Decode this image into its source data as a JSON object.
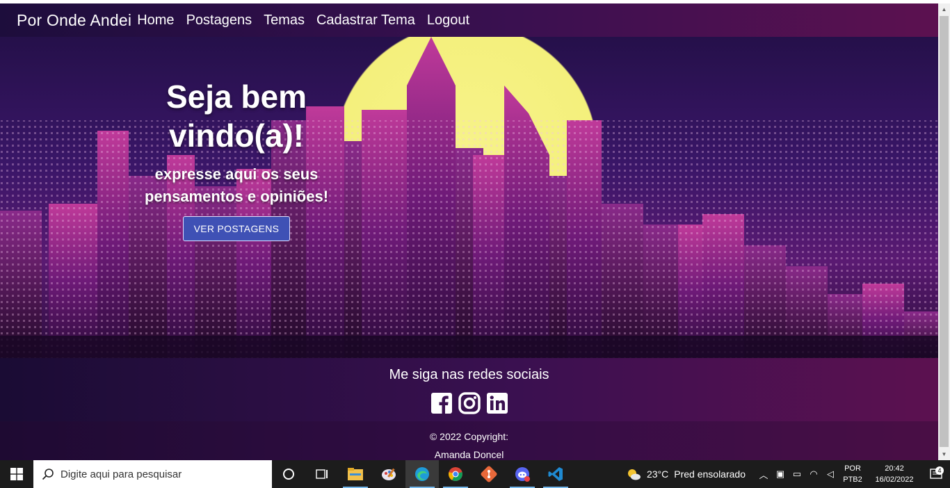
{
  "navbar": {
    "brand": "Por Onde Andei",
    "links": [
      "Home",
      "Postagens",
      "Temas",
      "Cadastrar Tema",
      "Logout"
    ]
  },
  "hero": {
    "title_line1": "Seja bem",
    "title_line2": "vindo(a)!",
    "subtitle_line1": "expresse aqui os seus",
    "subtitle_line2": "pensamentos e opiniões!",
    "button_label": "VER POSTAGENS"
  },
  "footer": {
    "heading": "Me siga nas redes sociais",
    "social_icons": [
      "facebook-icon",
      "instagram-icon",
      "linkedin-icon"
    ],
    "copyright_line1": "© 2022 Copyright:",
    "copyright_line2": "Amanda Doncel"
  },
  "taskbar": {
    "search_placeholder": "Digite aqui para pesquisar",
    "pinned_apps": [
      "cortana-icon",
      "task-view-icon",
      "file-explorer-icon",
      "paint-icon",
      "edge-icon",
      "chrome-icon",
      "git-icon",
      "discord-icon",
      "vscode-icon"
    ],
    "weather_temp": "23°C",
    "weather_desc": "Pred ensolarado",
    "lang_line1": "POR",
    "lang_line2": "PTB2",
    "time": "20:42",
    "date": "16/02/2022",
    "notification_count": "4"
  },
  "colors": {
    "nav_bg_start": "#1d0d3c",
    "nav_bg_end": "#5c1150",
    "button_bg": "#3f51b5",
    "moon": "#f4f07c"
  }
}
